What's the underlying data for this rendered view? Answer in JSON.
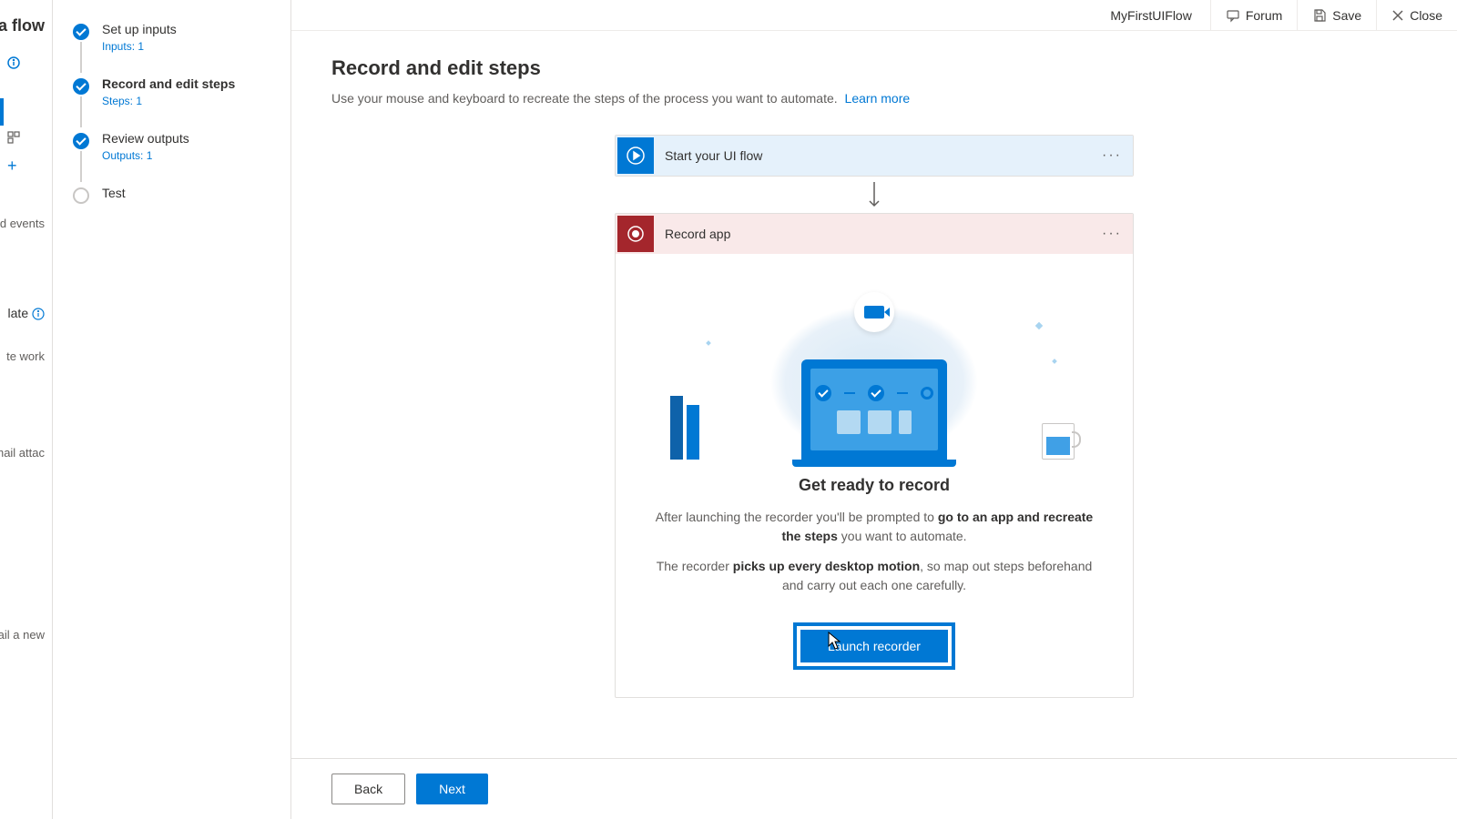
{
  "header": {
    "flow_name": "MyFirstUIFlow",
    "forum": "Forum",
    "save": "Save",
    "close": "Close"
  },
  "left_strip": {
    "title_fragment": "ake a flow",
    "item1": "nated events",
    "item2": "late",
    "item3": "te work",
    "item4": "mail attac",
    "item5": "email a new"
  },
  "stepper": [
    {
      "title": "Set up inputs",
      "sub": "Inputs: 1",
      "state": "done"
    },
    {
      "title": "Record and edit steps",
      "sub": "Steps: 1",
      "state": "current"
    },
    {
      "title": "Review outputs",
      "sub": "Outputs: 1",
      "state": "done"
    },
    {
      "title": "Test",
      "sub": "",
      "state": "empty"
    }
  ],
  "main": {
    "title": "Record and edit steps",
    "desc": "Use your mouse and keyboard to recreate the steps of the process you want to automate.",
    "learn_more": "Learn more"
  },
  "flow": {
    "start_label": "Start your UI flow",
    "record_label": "Record app"
  },
  "record_body": {
    "title": "Get ready to record",
    "p1_pre": "After launching the recorder you'll be prompted to ",
    "p1_bold": "go to an app and recreate the steps",
    "p1_post": " you want to automate.",
    "p2_pre": "The recorder ",
    "p2_bold": "picks up every desktop motion",
    "p2_post": ", so map out steps beforehand and carry out each one carefully.",
    "launch": "Launch recorder"
  },
  "footer": {
    "back": "Back",
    "next": "Next"
  }
}
